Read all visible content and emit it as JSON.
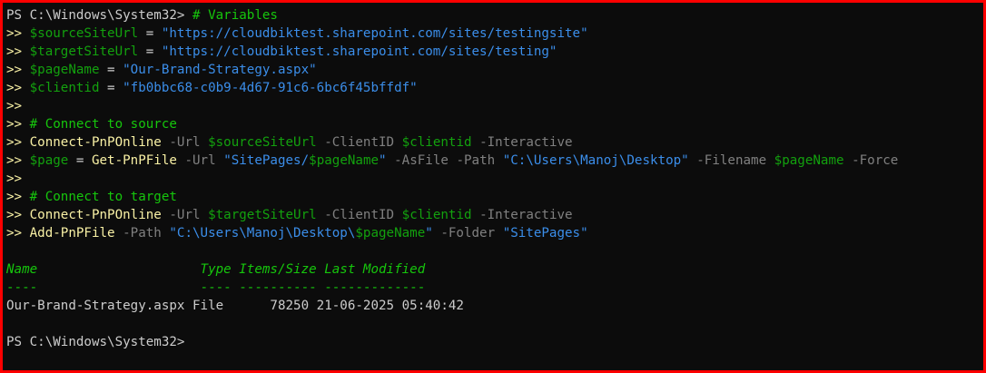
{
  "prompt": "PS C:\\Windows\\System32>",
  "continuation": ">>",
  "lines": [
    [
      {
        "t": "PS C:\\Windows\\System32> ",
        "c": "text"
      },
      {
        "t": "# Variables",
        "c": "comment"
      }
    ],
    [
      {
        "t": ">> ",
        "c": "cmd"
      },
      {
        "t": "$sourceSiteUrl",
        "c": "var"
      },
      {
        "t": " = ",
        "c": "text"
      },
      {
        "t": "\"https://cloudbiktest.sharepoint.com/sites/testingsite\"",
        "c": "str"
      }
    ],
    [
      {
        "t": ">> ",
        "c": "cmd"
      },
      {
        "t": "$targetSiteUrl",
        "c": "var"
      },
      {
        "t": " = ",
        "c": "text"
      },
      {
        "t": "\"https://cloudbiktest.sharepoint.com/sites/testing\"",
        "c": "str"
      }
    ],
    [
      {
        "t": ">> ",
        "c": "cmd"
      },
      {
        "t": "$pageName",
        "c": "var"
      },
      {
        "t": " = ",
        "c": "text"
      },
      {
        "t": "\"Our-Brand-Strategy.aspx\"",
        "c": "str"
      }
    ],
    [
      {
        "t": ">> ",
        "c": "cmd"
      },
      {
        "t": "$clientid",
        "c": "var"
      },
      {
        "t": " = ",
        "c": "text"
      },
      {
        "t": "\"fb0bbc68-c0b9-4d67-91c6-6bc6f45bffdf\"",
        "c": "str"
      }
    ],
    [
      {
        "t": ">>",
        "c": "cmd"
      }
    ],
    [
      {
        "t": ">> ",
        "c": "cmd"
      },
      {
        "t": "# Connect to source",
        "c": "comment"
      }
    ],
    [
      {
        "t": ">> ",
        "c": "cmd"
      },
      {
        "t": "Connect-PnPOnline",
        "c": "cmd"
      },
      {
        "t": " -Url ",
        "c": "param"
      },
      {
        "t": "$sourceSiteUrl",
        "c": "var"
      },
      {
        "t": " -ClientID ",
        "c": "param"
      },
      {
        "t": "$clientid",
        "c": "var"
      },
      {
        "t": " -Interactive",
        "c": "param"
      }
    ],
    [
      {
        "t": ">> ",
        "c": "cmd"
      },
      {
        "t": "$page",
        "c": "var"
      },
      {
        "t": " = ",
        "c": "text"
      },
      {
        "t": "Get-PnPFile",
        "c": "cmd"
      },
      {
        "t": " -Url ",
        "c": "param"
      },
      {
        "t": "\"SitePages/",
        "c": "str"
      },
      {
        "t": "$pageName",
        "c": "var"
      },
      {
        "t": "\"",
        "c": "str"
      },
      {
        "t": " -AsFile ",
        "c": "param"
      },
      {
        "t": "-Path ",
        "c": "param"
      },
      {
        "t": "\"C:\\Users\\Manoj\\Desktop\"",
        "c": "str"
      },
      {
        "t": " -Filename ",
        "c": "param"
      },
      {
        "t": "$pageName",
        "c": "var"
      },
      {
        "t": " -Force",
        "c": "param"
      }
    ],
    [
      {
        "t": ">>",
        "c": "cmd"
      }
    ],
    [
      {
        "t": ">> ",
        "c": "cmd"
      },
      {
        "t": "# Connect to target",
        "c": "comment"
      }
    ],
    [
      {
        "t": ">> ",
        "c": "cmd"
      },
      {
        "t": "Connect-PnPOnline",
        "c": "cmd"
      },
      {
        "t": " -Url ",
        "c": "param"
      },
      {
        "t": "$targetSiteUrl",
        "c": "var"
      },
      {
        "t": " -ClientID ",
        "c": "param"
      },
      {
        "t": "$clientid",
        "c": "var"
      },
      {
        "t": " -Interactive",
        "c": "param"
      }
    ],
    [
      {
        "t": ">> ",
        "c": "cmd"
      },
      {
        "t": "Add-PnPFile",
        "c": "cmd"
      },
      {
        "t": " -Path ",
        "c": "param"
      },
      {
        "t": "\"C:\\Users\\Manoj\\Desktop\\",
        "c": "str"
      },
      {
        "t": "$pageName",
        "c": "var"
      },
      {
        "t": "\"",
        "c": "str"
      },
      {
        "t": " -Folder ",
        "c": "param"
      },
      {
        "t": "\"SitePages\"",
        "c": "str"
      }
    ],
    [],
    [
      {
        "t": "Name                     ",
        "c": "header"
      },
      {
        "t": "Type Items/Size Last Modified",
        "c": "header"
      }
    ],
    [
      {
        "t": "----                     ---- ---------- -------------",
        "c": "comment"
      }
    ],
    [
      {
        "t": "Our-Brand-Strategy.aspx File      78250 21-06-2025 05:40:42",
        "c": "text"
      }
    ],
    [],
    [
      {
        "t": "PS C:\\Windows\\System32>",
        "c": "text"
      }
    ]
  ],
  "colors": {
    "text": "#cccccc",
    "var": "#13a10e",
    "str": "#3b8eea",
    "cmd": "#f9f1a5",
    "param": "#808080",
    "comment": "#16c60c",
    "background": "#0c0c0c",
    "border": "#ff0000"
  }
}
